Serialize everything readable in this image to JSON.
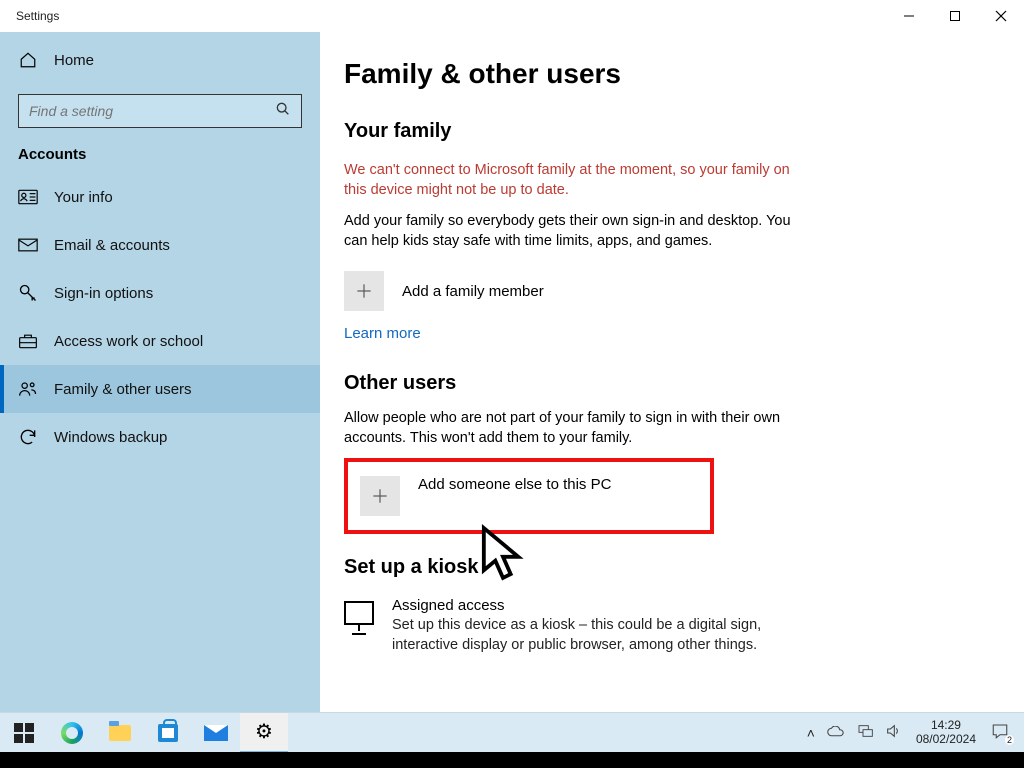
{
  "window": {
    "title": "Settings"
  },
  "sidebar": {
    "home": "Home",
    "search_placeholder": "Find a setting",
    "category": "Accounts",
    "items": [
      {
        "label": "Your info"
      },
      {
        "label": "Email & accounts"
      },
      {
        "label": "Sign-in options"
      },
      {
        "label": "Access work or school"
      },
      {
        "label": "Family & other users"
      },
      {
        "label": "Windows backup"
      }
    ]
  },
  "page": {
    "title": "Family & other users",
    "family": {
      "heading": "Your family",
      "warning": "We can't connect to Microsoft family at the moment, so your family on this device might not be up to date.",
      "description": "Add your family so everybody gets their own sign-in and desktop. You can help kids stay safe with time limits, apps, and games.",
      "add_label": "Add a family member",
      "learn_more": "Learn more"
    },
    "other": {
      "heading": "Other users",
      "description": "Allow people who are not part of your family to sign in with their own accounts. This won't add them to your family.",
      "add_label": "Add someone else to this PC"
    },
    "kiosk": {
      "heading": "Set up a kiosk",
      "item_title": "Assigned access",
      "item_desc": "Set up this device as a kiosk – this could be a digital sign, interactive display or public browser, among other things."
    }
  },
  "taskbar": {
    "time": "14:29",
    "date": "08/02/2024",
    "notification_count": "2"
  },
  "annotation": {
    "highlight_color": "#e11"
  }
}
